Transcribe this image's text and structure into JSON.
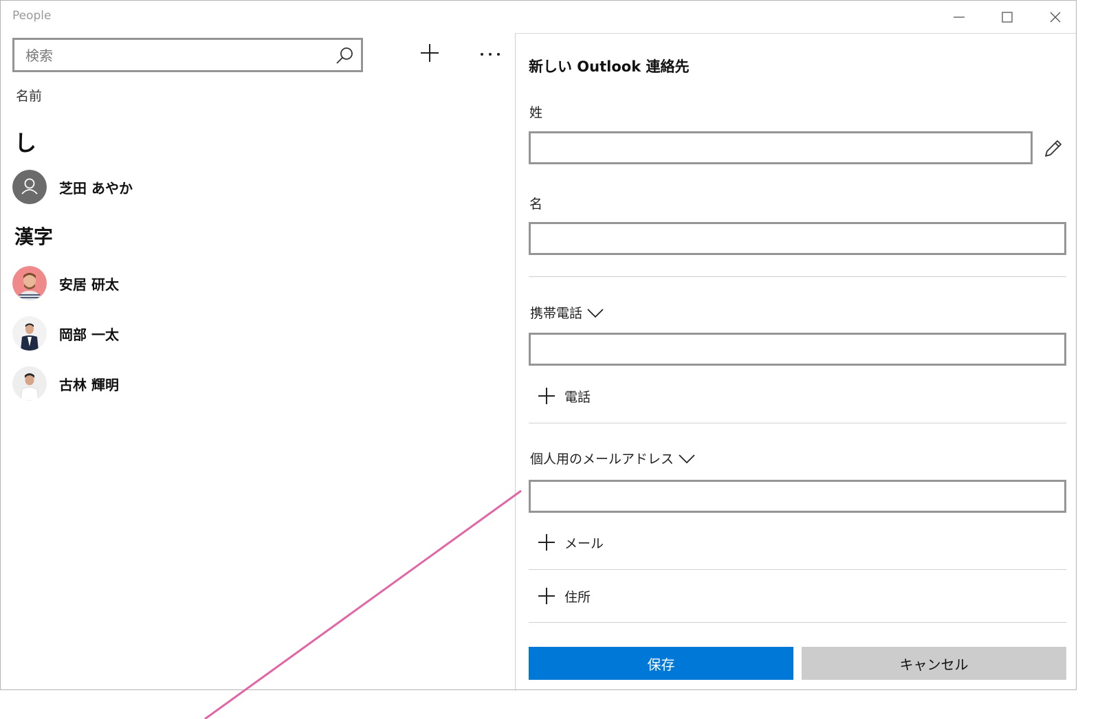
{
  "window": {
    "title": "People"
  },
  "left_pane": {
    "search": {
      "placeholder": "検索",
      "value": ""
    },
    "sort_label": "名前",
    "groups": [
      {
        "header": "し",
        "contacts": [
          {
            "name": "芝田 あやか",
            "avatar": "default-person-icon"
          }
        ]
      },
      {
        "header": "漢字",
        "contacts": [
          {
            "name": "安居 研太",
            "avatar": "photo"
          },
          {
            "name": "岡部 一太",
            "avatar": "photo"
          },
          {
            "name": "古林 輝明",
            "avatar": "photo"
          }
        ]
      }
    ]
  },
  "form": {
    "title": "新しい Outlook 連絡先",
    "last_name_label": "姓",
    "first_name_label": "名",
    "phone_type": "携帯電話",
    "add_phone_label": "電話",
    "email_type": "個人用のメールアドレス",
    "add_email_label": "メール",
    "add_address_label": "住所",
    "save_label": "保存",
    "cancel_label": "キャンセル"
  },
  "colors": {
    "accent": "#0078d7",
    "cancel_bg": "#cccccc",
    "field_border": "#959595",
    "annotation_line": "#e066a6"
  }
}
